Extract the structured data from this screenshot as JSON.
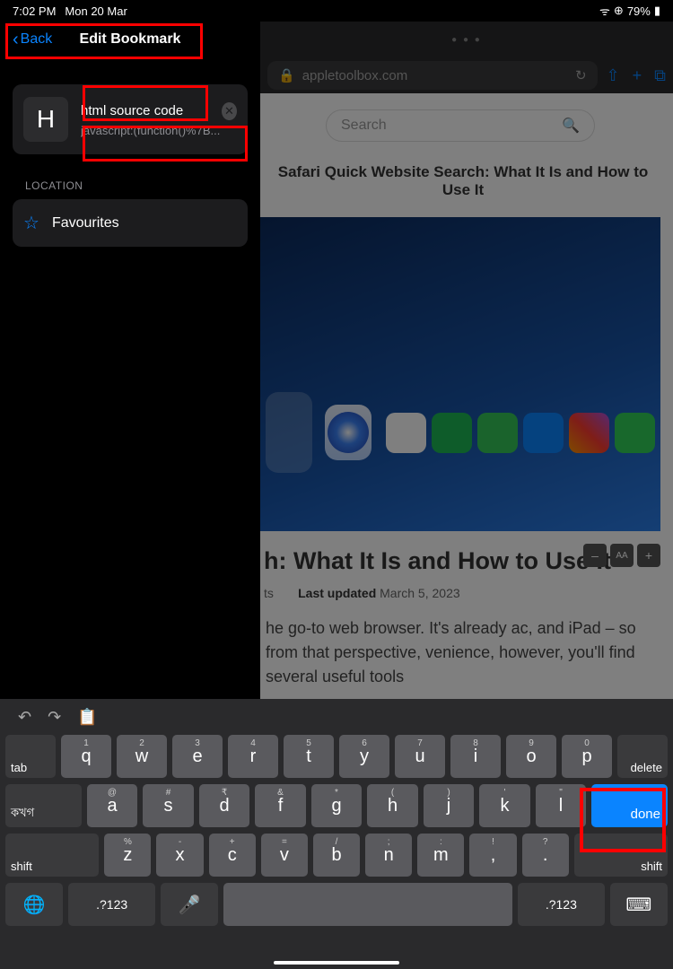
{
  "status": {
    "time": "7:02 PM",
    "date": "Mon 20 Mar",
    "battery": "79%",
    "wifi": "wifi",
    "orientation": "lock"
  },
  "sidebar": {
    "back": "Back",
    "title": "Edit Bookmark",
    "favicon_letter": "H",
    "name_value": "html source code",
    "url_value": "javascript:(function()%7B...",
    "location_label": "LOCATION",
    "location_value": "Favourites"
  },
  "browser": {
    "domain": "appletoolbox.com",
    "lock": "🔒",
    "refresh": "↻",
    "search_placeholder": "Search"
  },
  "article": {
    "top_title": "Safari Quick Website Search: What It Is and How to Use It",
    "h1": "h: What It Is and How to Use It",
    "meta_author": "ts",
    "meta_updated_label": "Last updated",
    "meta_updated_date": "March 5, 2023",
    "body": "he go-to web browser. It's already ac, and iPad – so from that perspective, venience, however, you'll find several useful tools"
  },
  "keyboard": {
    "row1_nums": [
      "1",
      "2",
      "3",
      "4",
      "5",
      "6",
      "7",
      "8",
      "9",
      "0"
    ],
    "row1_letters": [
      "q",
      "w",
      "e",
      "r",
      "t",
      "y",
      "u",
      "i",
      "o",
      "p"
    ],
    "row2_syms": [
      "@",
      "#",
      "₹",
      "&",
      "*",
      "(",
      ")",
      "'",
      "\""
    ],
    "row2_letters": [
      "a",
      "s",
      "d",
      "f",
      "g",
      "h",
      "j",
      "k",
      "l"
    ],
    "row3_syms": [
      "%",
      "-",
      "+",
      "=",
      "/",
      ";",
      ":",
      "!",
      "?"
    ],
    "row3_letters": [
      "z",
      "x",
      "c",
      "v",
      "b",
      "n",
      "m",
      ",",
      "."
    ],
    "tab": "tab",
    "delete": "delete",
    "lang": "কখগ",
    "done": "done",
    "shift": "shift",
    "numsym": ".?123",
    "globe": "🌐",
    "mic": "🎤",
    "kbd": "⌨"
  }
}
